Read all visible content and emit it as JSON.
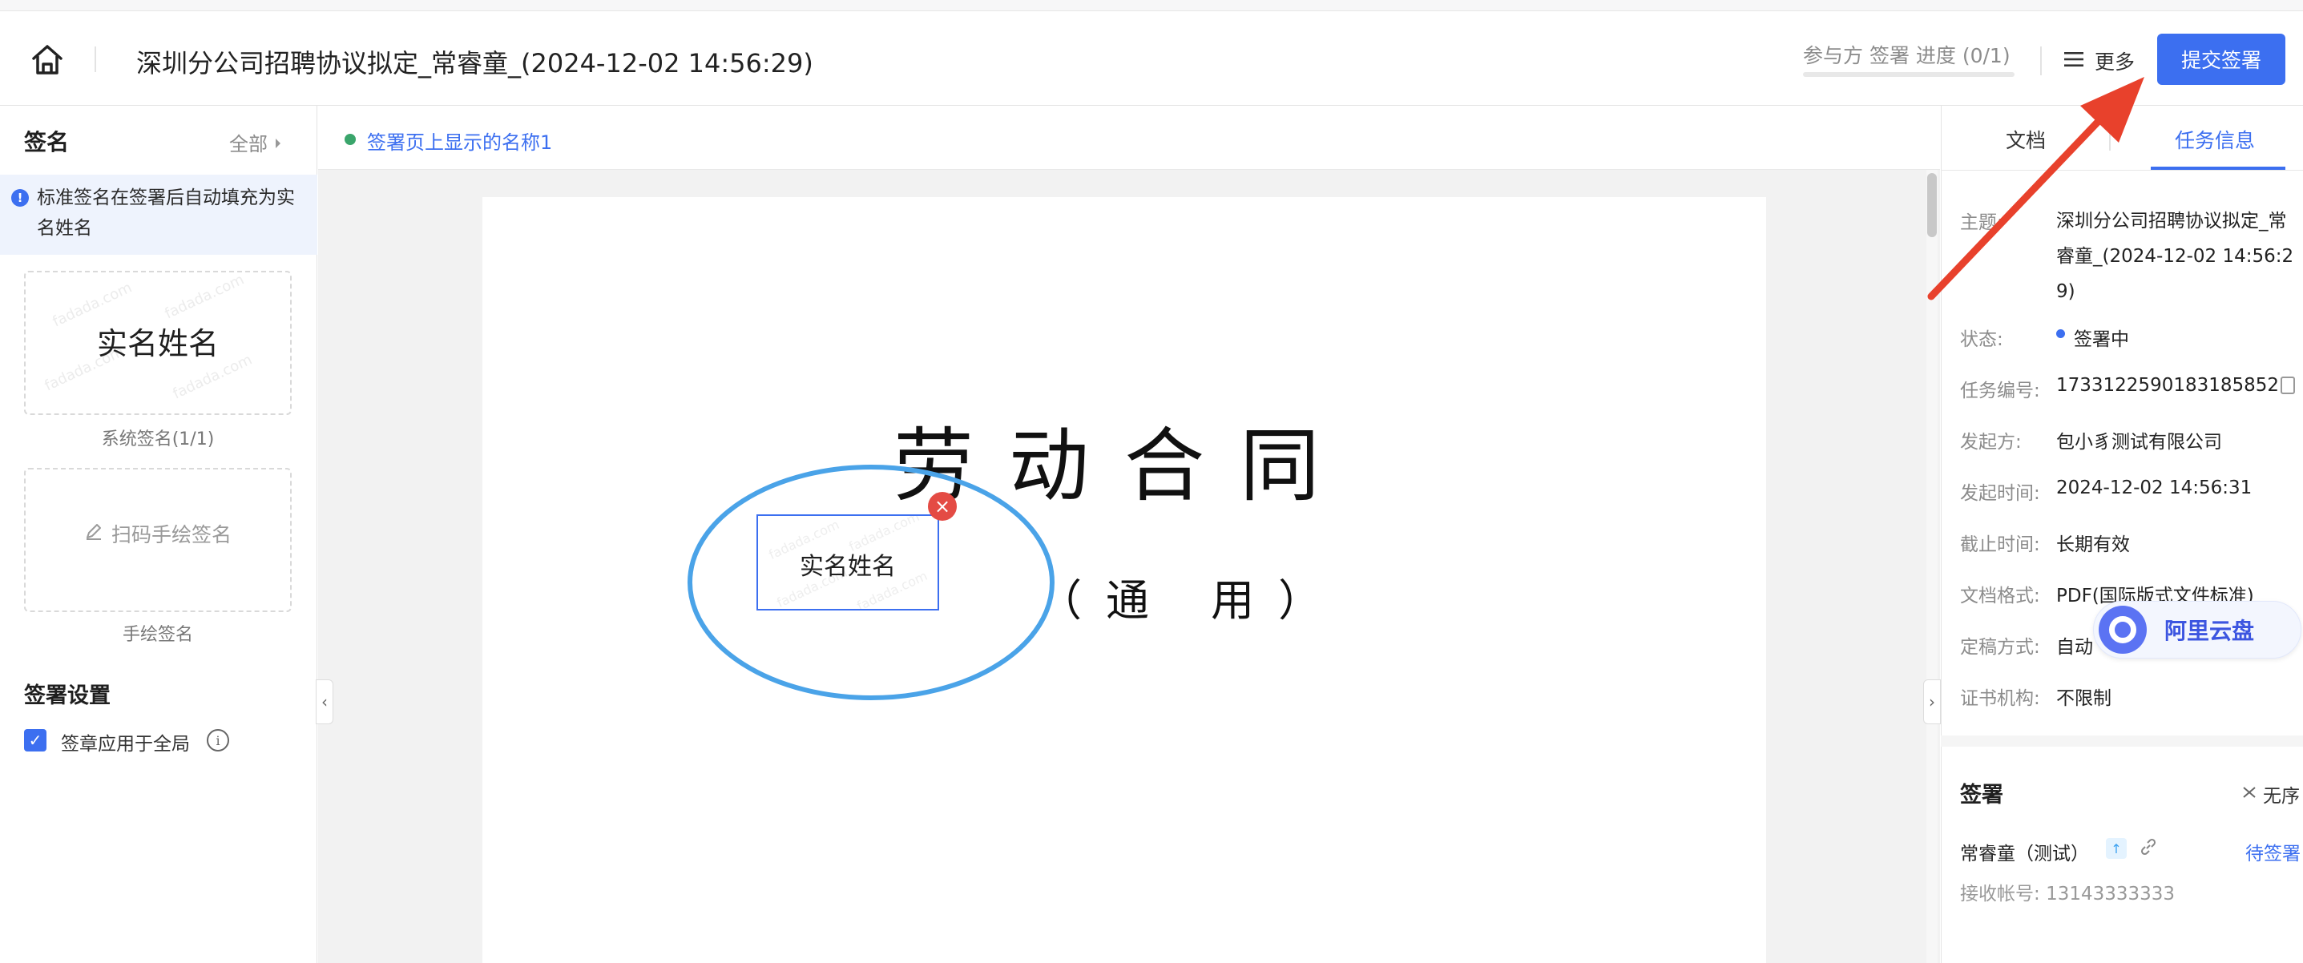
{
  "header": {
    "title": "深圳分公司招聘协议拟定_常睿童_(2024-12-02 14:56:29)",
    "progress_label": "参与方 签署 进度 (0/1)",
    "more_label": "更多",
    "submit_label": "提交签署",
    "home_icon": "home-icon"
  },
  "left_panel": {
    "title": "签名",
    "all_label": "全部",
    "tip": "标准签名在签署后自动填充为实名姓名",
    "system_signature_text": "实名姓名",
    "system_signature_caption": "系统签名(1/1)",
    "hand_signature_text": "扫码手绘签名",
    "hand_signature_caption": "手绘签名",
    "settings_title": "签署设置",
    "apply_global_label": "签章应用于全局",
    "apply_global_checked": true,
    "watermark_text": "fadada.com"
  },
  "center": {
    "display_name_label": "签署页上显示的名称1",
    "doc_title": "劳动合同",
    "doc_subtitle": "（通 用）",
    "signature_field_text": "实名姓名"
  },
  "right_panel": {
    "tabs": [
      {
        "label": "文档",
        "active": false
      },
      {
        "label": "任务信息",
        "active": true
      }
    ],
    "info": {
      "subject_label": "主题:",
      "subject_value": "深圳分公司招聘协议拟定_常睿童_(2024-12-02 14:56:29)",
      "status_label": "状态:",
      "status_value": "签署中",
      "task_no_label": "任务编号:",
      "task_no_value": "1733122590183185852",
      "initiator_label": "发起方:",
      "initiator_value": "包小豸测试有限公司",
      "start_time_label": "发起时间:",
      "start_time_value": "2024-12-02 14:56:31",
      "deadline_label": "截止时间:",
      "deadline_value": "长期有效",
      "format_label": "文档格式:",
      "format_value": "PDF(国际版式文件标准)",
      "finalize_label": "定稿方式:",
      "finalize_value": "自动",
      "cert_label": "证书机构:",
      "cert_value": "不限制"
    },
    "signing": {
      "title": "签署",
      "order_mode": "无序",
      "signer_name": "常睿童（测试）",
      "signer_status": "待签署",
      "receiver_label": "接收帐号:",
      "receiver_value": "13143333333"
    }
  },
  "floating": {
    "aliyun_label": "阿里云盘"
  },
  "colors": {
    "accent": "#3c6ff0",
    "annotation_red": "#e8412c",
    "annotation_blue": "#4aa3e8",
    "status_green": "#3aa56b"
  }
}
